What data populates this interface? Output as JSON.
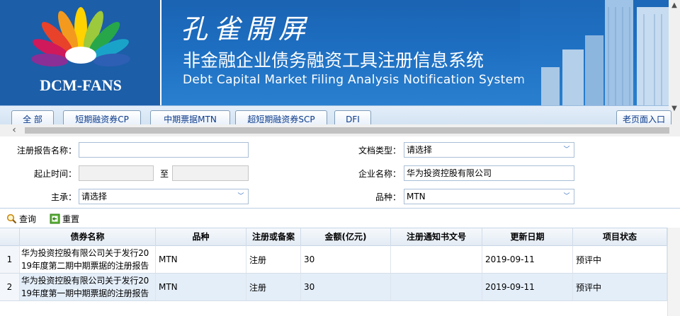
{
  "banner": {
    "logo_text": "DCM-FANS",
    "calligraphy": "孔雀開屏",
    "title_cn": "非金融企业债务融资工具注册信息系统",
    "title_en": "Debt Capital Market Filing Analysis Notification System"
  },
  "tabs": [
    {
      "label": "全 部"
    },
    {
      "label": "短期融资券CP"
    },
    {
      "label": "中期票据MTN"
    },
    {
      "label": "超短期融资券SCP"
    },
    {
      "label": "DFI"
    },
    {
      "label": "老页面入口"
    }
  ],
  "form": {
    "report_name_label": "注册报告名称：",
    "report_name_value": "",
    "date_range_label": "起止时间：",
    "date_to_label": "至",
    "lead_label": "主承：",
    "lead_value": "请选择",
    "doc_type_label": "文档类型：",
    "doc_type_value": "请选择",
    "company_label": "企业名称：",
    "company_value": "华为投资控股有限公司",
    "variety_label": "品种：",
    "variety_value": "MTN"
  },
  "toolbar": {
    "search_label": "查询",
    "reset_label": "重置"
  },
  "table": {
    "columns": [
      "",
      "债券名称",
      "品种",
      "注册或备案",
      "金额(亿元)",
      "注册通知书文号",
      "更新日期",
      "项目状态"
    ],
    "rows": [
      {
        "rn": "1",
        "name_line1": "华为投资控股有限公司关于发行20",
        "name_line2": "19年度第二期中期票据的注册报告",
        "variety": "MTN",
        "type": "注册",
        "amount": "30",
        "notice_no": "",
        "date": "2019-09-11",
        "status": "预评中"
      },
      {
        "rn": "2",
        "name_line1": "华为投资控股有限公司关于发行20",
        "name_line2": "19年度第一期中期票据的注册报告",
        "variety": "MTN",
        "type": "注册",
        "amount": "30",
        "notice_no": "",
        "date": "2019-09-11",
        "status": "预评中"
      }
    ]
  },
  "colors": {
    "banner_blue": "#1d6ec1",
    "tab_text": "#0b3a8a",
    "row_alt": "#e4eef9"
  }
}
